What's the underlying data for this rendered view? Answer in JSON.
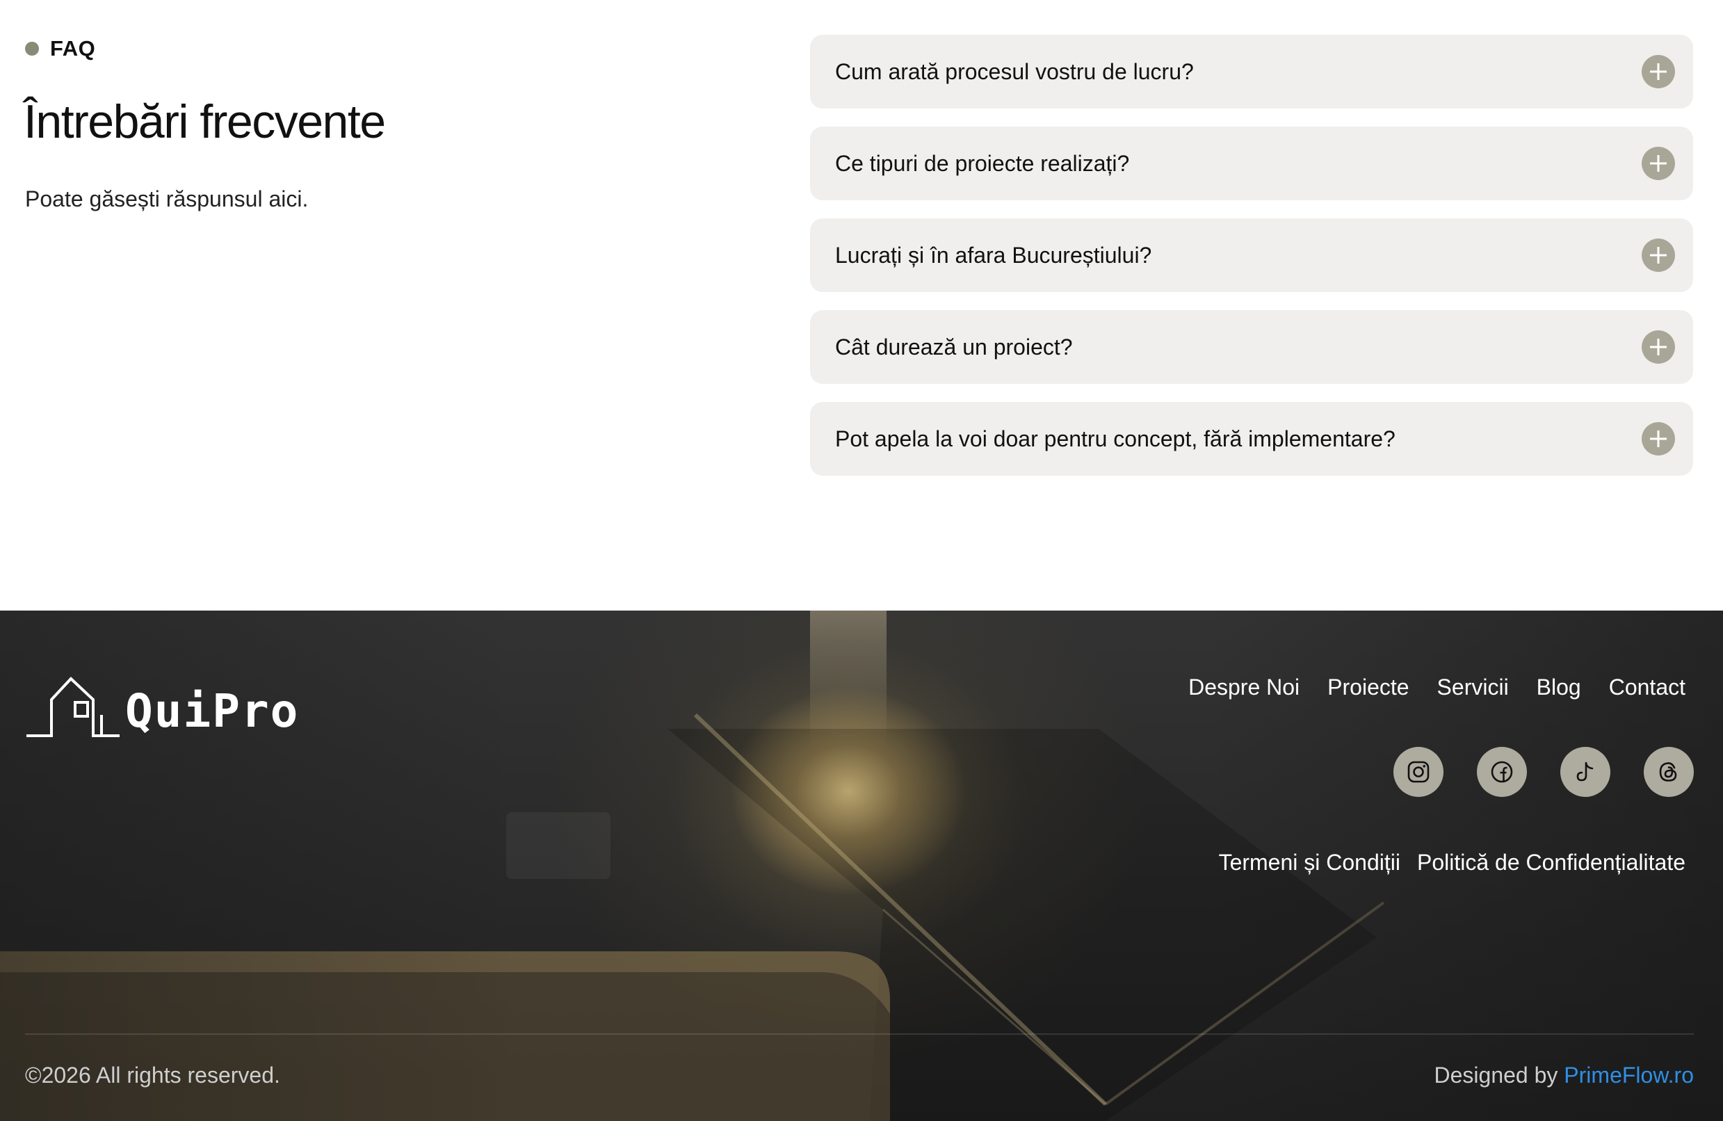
{
  "faq": {
    "tag": "FAQ",
    "title": "Întrebări frecvente",
    "subtitle": "Poate găsești răspunsul aici.",
    "questions": [
      "Cum arată procesul vostru de lucru?",
      "Ce tipuri de proiecte realizați?",
      "Lucrați și în afara Bucureștiului?",
      "Cât durează un proiect?",
      "Pot apela la voi doar pentru concept, fără implementare?"
    ]
  },
  "footer": {
    "logo_text": "QuiPro",
    "nav": [
      "Despre Noi",
      "Proiecte",
      "Servicii",
      "Blog",
      "Contact"
    ],
    "socials": [
      "instagram-icon",
      "facebook-icon",
      "tiktok-icon",
      "threads-icon"
    ],
    "legal": [
      "Termeni și Condiții",
      "Politică de Confidențialitate"
    ],
    "copyright": "©2026 All rights reserved.",
    "designed_by_prefix": "Designed by",
    "designed_by_link": "PrimeFlow.ro"
  },
  "colors": {
    "accent_dot": "#8a8a78",
    "plus_button": "#a8a797",
    "faq_item_bg": "#f0efed",
    "social_button": "#aeac9f",
    "link_blue": "#2f8fe6",
    "footer_bg": "#2a2a2a"
  }
}
